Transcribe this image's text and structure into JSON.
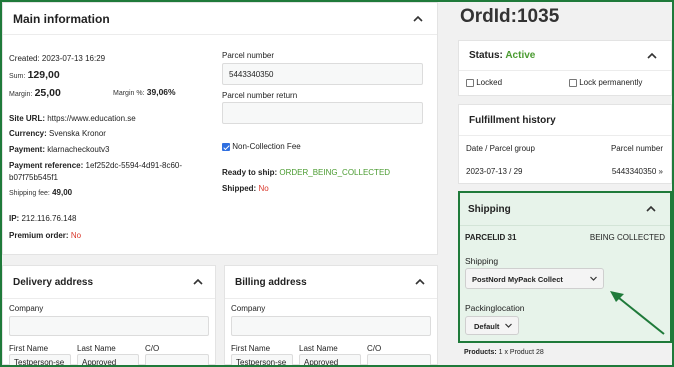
{
  "main_info": {
    "title": "Main information",
    "created_label": "Created:",
    "created_value": "2023-07-13 16:29",
    "sum_label": "Sum:",
    "sum_value": "129,00",
    "margin_label": "Margin:",
    "margin_value": "25,00",
    "margin_pct_label": "Margin %:",
    "margin_pct_value": "39,06%",
    "site_url_label": "Site URL:",
    "site_url_value": "https://www.education.se",
    "currency_label": "Currency:",
    "currency_value": "Svenska Kronor",
    "payment_label": "Payment:",
    "payment_value": "klarnacheckoutv3",
    "payment_ref_label": "Payment reference:",
    "payment_ref_value_1": "1ef252dc-5594-4d91-8c60-",
    "payment_ref_value_2": "b07f75b545f1",
    "shipping_fee_label": "Shipping fee:",
    "shipping_fee_value": "49,00",
    "ip_label": "IP:",
    "ip_value": "212.116.76.148",
    "premium_label": "Premium order:",
    "premium_value": "No",
    "parcel_number_label": "Parcel number",
    "parcel_number_value": "5443340350",
    "parcel_return_label": "Parcel number return",
    "parcel_return_value": "",
    "non_collection_label": "Non-Collection Fee",
    "ready_label": "Ready to ship:",
    "ready_value": "ORDER_BEING_COLLECTED",
    "shipped_label": "Shipped:",
    "shipped_value": "No"
  },
  "delivery": {
    "title": "Delivery address",
    "company_label": "Company",
    "first_name_label": "First Name",
    "last_name_label": "Last Name",
    "co_label": "C/O",
    "first_name_value": "Testperson-se",
    "last_name_value": "Approved"
  },
  "billing": {
    "title": "Billing address",
    "company_label": "Company",
    "first_name_label": "First Name",
    "last_name_label": "Last Name",
    "co_label": "C/O",
    "first_name_value": "Testperson-se",
    "last_name_value": "Approved"
  },
  "order": {
    "title": "OrdId:1035"
  },
  "status": {
    "label": "Status:",
    "value": "Active",
    "locked_label": "Locked",
    "locked_perm_label": "Lock permanently"
  },
  "fulfillment": {
    "title": "Fulfillment history",
    "col1": "Date / Parcel group",
    "col2": "Parcel number",
    "row_date": "2023-07-13 / 29",
    "row_parcel": "5443340350 »"
  },
  "shipping": {
    "title": "Shipping",
    "parcel_id": "PARCELID 31",
    "parcel_status": "BEING COLLECTED",
    "shipping_label": "Shipping",
    "shipping_selected": "PostNord MyPack Collect",
    "packing_label": "Packinglocation",
    "packing_selected": "Default"
  },
  "products": {
    "label": "Products:",
    "value": "1 x Product 28"
  },
  "colors": {
    "accent_green": "#1f7a3a",
    "status_green": "#4a9b30",
    "no_red": "#d9372b"
  }
}
